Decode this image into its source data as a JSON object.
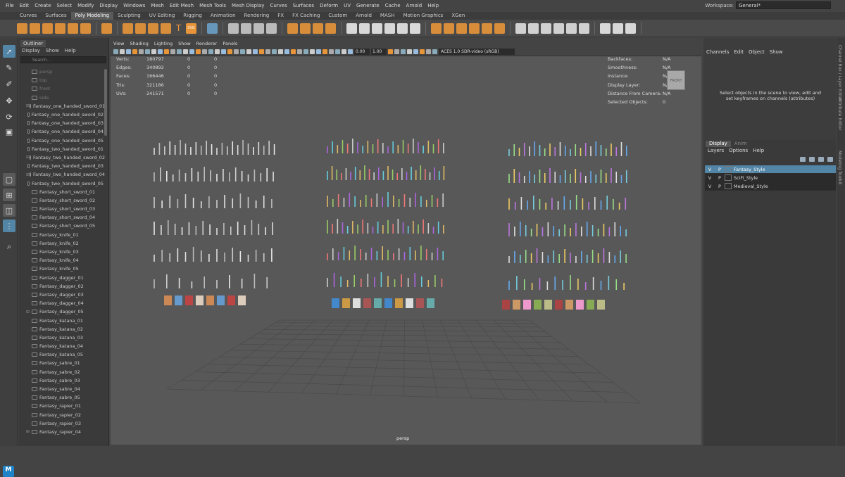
{
  "menubar": [
    "File",
    "Edit",
    "Create",
    "Select",
    "Modify",
    "Display",
    "Windows",
    "Mesh",
    "Edit Mesh",
    "Mesh Tools",
    "Mesh Display",
    "Curves",
    "Surfaces",
    "Deform",
    "UV",
    "Generate",
    "Cache",
    "Arnold",
    "Help"
  ],
  "workspace": {
    "label": "Workspace:",
    "value": "General*"
  },
  "shelf_tabs": [
    "Curves",
    "Surfaces",
    "Poly Modeling",
    "Sculpting",
    "UV Editing",
    "Rigging",
    "Animation",
    "Rendering",
    "FX",
    "FX Caching",
    "Custom",
    "Arnold",
    "MASH",
    "Motion Graphics",
    "XGen"
  ],
  "shelf_active": "Poly Modeling",
  "shelf_text_icons": {
    "text_tool": "T",
    "svg_tool": "SVG"
  },
  "outliner": {
    "title": "Outliner",
    "menu": [
      "Display",
      "Show",
      "Help"
    ],
    "search_placeholder": "Search...",
    "items": [
      {
        "label": "persp",
        "cam": true
      },
      {
        "label": "top",
        "cam": true
      },
      {
        "label": "front",
        "cam": true
      },
      {
        "label": "side",
        "cam": true
      },
      {
        "label": "Fantasy_one_handed_sword_01",
        "exp": true
      },
      {
        "label": "Fantasy_one_handed_sword_02"
      },
      {
        "label": "Fantasy_one_handed_sword_03"
      },
      {
        "label": "Fantasy_one_handed_sword_04"
      },
      {
        "label": "Fantasy_one_handed_sword_05"
      },
      {
        "label": "Fantasy_two_handed_sword_01"
      },
      {
        "label": "Fantasy_two_handed_sword_02",
        "exp": true
      },
      {
        "label": "Fantasy_two_handed_sword_03"
      },
      {
        "label": "Fantasy_two_handed_sword_04",
        "exp": true
      },
      {
        "label": "Fantasy_two_handed_sword_05"
      },
      {
        "label": "Fantasy_short_sword_01"
      },
      {
        "label": "Fantasy_short_sword_02"
      },
      {
        "label": "Fantasy_short_sword_03"
      },
      {
        "label": "Fantasy_short_sword_04"
      },
      {
        "label": "Fantasy_short_sword_05"
      },
      {
        "label": "Fantasy_knife_01"
      },
      {
        "label": "Fantasy_knife_02"
      },
      {
        "label": "Fantasy_knife_03"
      },
      {
        "label": "Fantasy_knife_04"
      },
      {
        "label": "Fantasy_knife_05"
      },
      {
        "label": "Fantasy_dagger_01"
      },
      {
        "label": "Fantasy_dagger_02"
      },
      {
        "label": "Fantasy_dagger_03"
      },
      {
        "label": "Fantasy_dagger_04"
      },
      {
        "label": "Fantasy_dagger_05",
        "exp": true
      },
      {
        "label": "Fantasy_katana_01"
      },
      {
        "label": "Fantasy_katana_02"
      },
      {
        "label": "Fantasy_katana_03"
      },
      {
        "label": "Fantasy_katana_04"
      },
      {
        "label": "Fantasy_katana_05"
      },
      {
        "label": "Fantasy_sabre_01"
      },
      {
        "label": "Fantasy_sabre_02"
      },
      {
        "label": "Fantasy_sabre_03"
      },
      {
        "label": "Fantasy_sabre_04"
      },
      {
        "label": "Fantasy_sabre_05"
      },
      {
        "label": "Fantasy_rapier_01"
      },
      {
        "label": "Fantasy_rapier_02"
      },
      {
        "label": "Fantasy_rapier_03"
      },
      {
        "label": "Fantasy_rapier_04",
        "exp": true
      }
    ]
  },
  "viewport": {
    "menu": [
      "View",
      "Shading",
      "Lighting",
      "Show",
      "Renderer",
      "Panels"
    ],
    "near": "0.00",
    "far": "1.00",
    "colorspace": "ACES 1.0 SDR-video (sRGB)",
    "stats": [
      {
        "k": "Verts:",
        "a": "180797",
        "b": "0",
        "c": "0"
      },
      {
        "k": "Edges:",
        "a": "340892",
        "b": "0",
        "c": "0"
      },
      {
        "k": "Faces:",
        "a": "166446",
        "b": "0",
        "c": "0"
      },
      {
        "k": "Tris:",
        "a": "321186",
        "b": "0",
        "c": "0"
      },
      {
        "k": "UVs:",
        "a": "241571",
        "b": "0",
        "c": "0"
      }
    ],
    "info": [
      {
        "k": "Backfaces:",
        "v": "N/A"
      },
      {
        "k": "Smoothness:",
        "v": "N/A"
      },
      {
        "k": "Instance:",
        "v": "N/A"
      },
      {
        "k": "Display Layer:",
        "v": "N/A"
      },
      {
        "k": "Distance From Camera:",
        "v": "N/A"
      },
      {
        "k": "Selected Objects:",
        "v": "0"
      }
    ],
    "cube_label": "FRONT",
    "camera": "persp"
  },
  "channel_box": {
    "menu": [
      "Channels",
      "Edit",
      "Object",
      "Show"
    ],
    "message": "Select objects in the scene to view, edit and set keyframes on channels (attributes)"
  },
  "layer_editor": {
    "tabs": [
      "Display",
      "Anim"
    ],
    "menu": [
      "Layers",
      "Options",
      "Help"
    ],
    "layers": [
      {
        "v": "V",
        "p": "P",
        "name": "Fantasy_Style",
        "selected": true
      },
      {
        "v": "V",
        "p": "P",
        "name": "SciFi_Style",
        "selected": false
      },
      {
        "v": "V",
        "p": "P",
        "name": "Medieval_Style",
        "selected": false
      }
    ]
  },
  "side_tabs": [
    "Channel Box / Layer Editor",
    "Attribute Editor",
    "Modeling Toolkit"
  ],
  "logo": "M",
  "colors": {
    "accent": "#e8953a",
    "selection": "#5285a6"
  }
}
